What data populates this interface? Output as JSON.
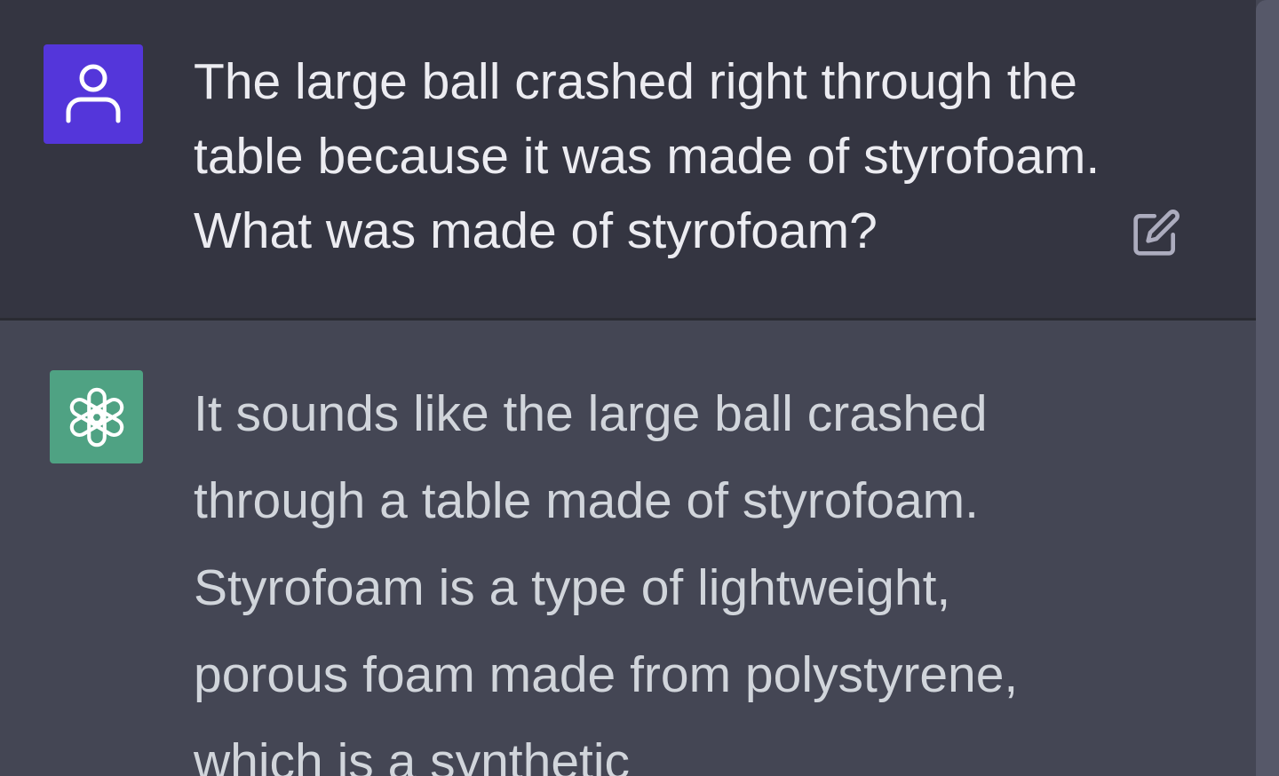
{
  "conversation": {
    "user_message": {
      "text": "The large ball crashed right through the table because it was made of styrofoam. What was made of styrofoam?"
    },
    "assistant_message": {
      "text": "It sounds like the large ball crashed through a table made of styrofoam. Styrofoam is a type of lightweight, porous foam made from polystyrene, which is a synthetic"
    }
  },
  "icons": {
    "user_avatar": "user-icon",
    "assistant_avatar": "openai-logo-icon",
    "edit": "edit-icon"
  },
  "colors": {
    "user_bg": "#343541",
    "assistant_bg": "#444654",
    "user_avatar_bg": "#5436da",
    "assistant_avatar_bg": "#4fa283",
    "text_user": "#ececf1",
    "text_assistant": "#d1d5db"
  }
}
